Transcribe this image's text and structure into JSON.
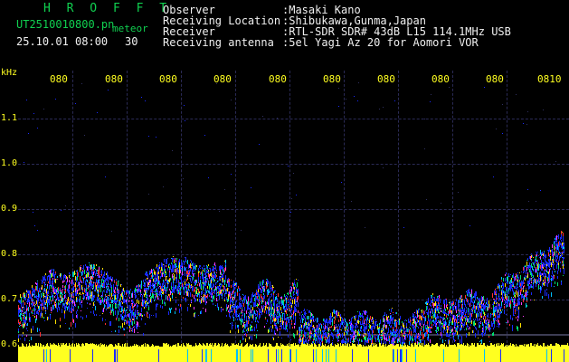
{
  "header": {
    "app_title": "H R O F F T",
    "file_name": "UT2510010800.pn",
    "meteor_label": "meteor",
    "date_time": "25.10.01 08:00",
    "count": "30"
  },
  "info": {
    "labels": [
      "Observer",
      "Receiving Location",
      "Receiver",
      "Receiving antenna"
    ],
    "values": [
      ":Masaki Kano",
      ":Shibukawa,Gunma,Japan",
      ":RTL-SDR SDR# 43dB L15 114.1MHz USB",
      ":5el Yagi Az 20 for Aomori VOR"
    ]
  },
  "axis": {
    "y_unit": "kHz",
    "y_ticks": [
      "1.1",
      "1.0",
      "0.9",
      "0.8",
      "0.7",
      "0.6"
    ],
    "x_ticks": [
      "080",
      "080",
      "080",
      "080",
      "080",
      "080",
      "080",
      "080",
      "080",
      "0810"
    ]
  },
  "colors": {
    "title": "#10d050",
    "text": "#f0f0f0",
    "ticks": "#ffff20",
    "noise_band": "#ffff20",
    "background": "#000000"
  }
}
